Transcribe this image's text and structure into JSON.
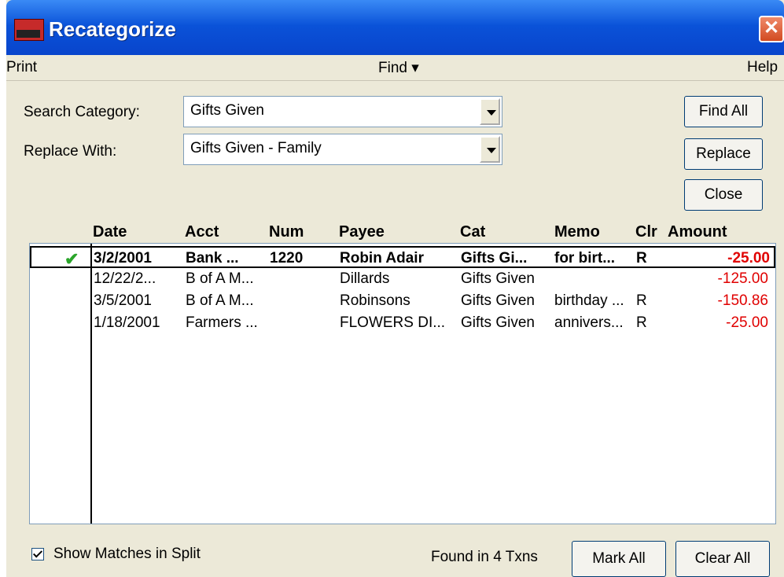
{
  "window": {
    "title": "Recategorize",
    "close_label": "✕"
  },
  "menu": {
    "print": "Print",
    "find": "Find ▾",
    "help": "Help"
  },
  "search": {
    "search_category_label": "Search Category:",
    "search_category_value": "Gifts Given",
    "replace_with_label": "Replace With:",
    "replace_with_value": "Gifts Given - Family"
  },
  "buttons": {
    "find_all": "Find All",
    "replace": "Replace",
    "close": "Close",
    "mark_all": "Mark All",
    "clear_all": "Clear All"
  },
  "columns": [
    "Date",
    "Acct",
    "Num",
    "Payee",
    "Cat",
    "Memo",
    "Clr",
    "Amount"
  ],
  "rows": [
    {
      "date": "3/2/2001",
      "acct": "Bank ...",
      "num": "1220",
      "payee": "Robin Adair",
      "cat": "Gifts Gi...",
      "memo": "for birt...",
      "clr": "R",
      "amount": "-25.00",
      "marked": true
    },
    {
      "date": "12/22/2...",
      "acct": "B of A M...",
      "num": "",
      "payee": "Dillards",
      "cat": "Gifts Given",
      "memo": "",
      "clr": "",
      "amount": "-125.00",
      "marked": false
    },
    {
      "date": "3/5/2001",
      "acct": "B of A M...",
      "num": "",
      "payee": "Robinsons",
      "cat": "Gifts Given",
      "memo": "birthday ...",
      "clr": "R",
      "amount": "-150.86",
      "marked": false
    },
    {
      "date": "1/18/2001",
      "acct": "Farmers ...",
      "num": "",
      "payee": "FLOWERS DI...",
      "cat": "Gifts Given",
      "memo": "annivers...",
      "clr": "R",
      "amount": "-25.00",
      "marked": false
    }
  ],
  "footer": {
    "show_matches_label": "Show Matches in Split",
    "show_matches_checked": true,
    "found_text": "Found in 4 Txns"
  },
  "colors": {
    "negative_amount": "#e00000",
    "titlebar": "#0a52d8",
    "check": "#2aa52a"
  }
}
